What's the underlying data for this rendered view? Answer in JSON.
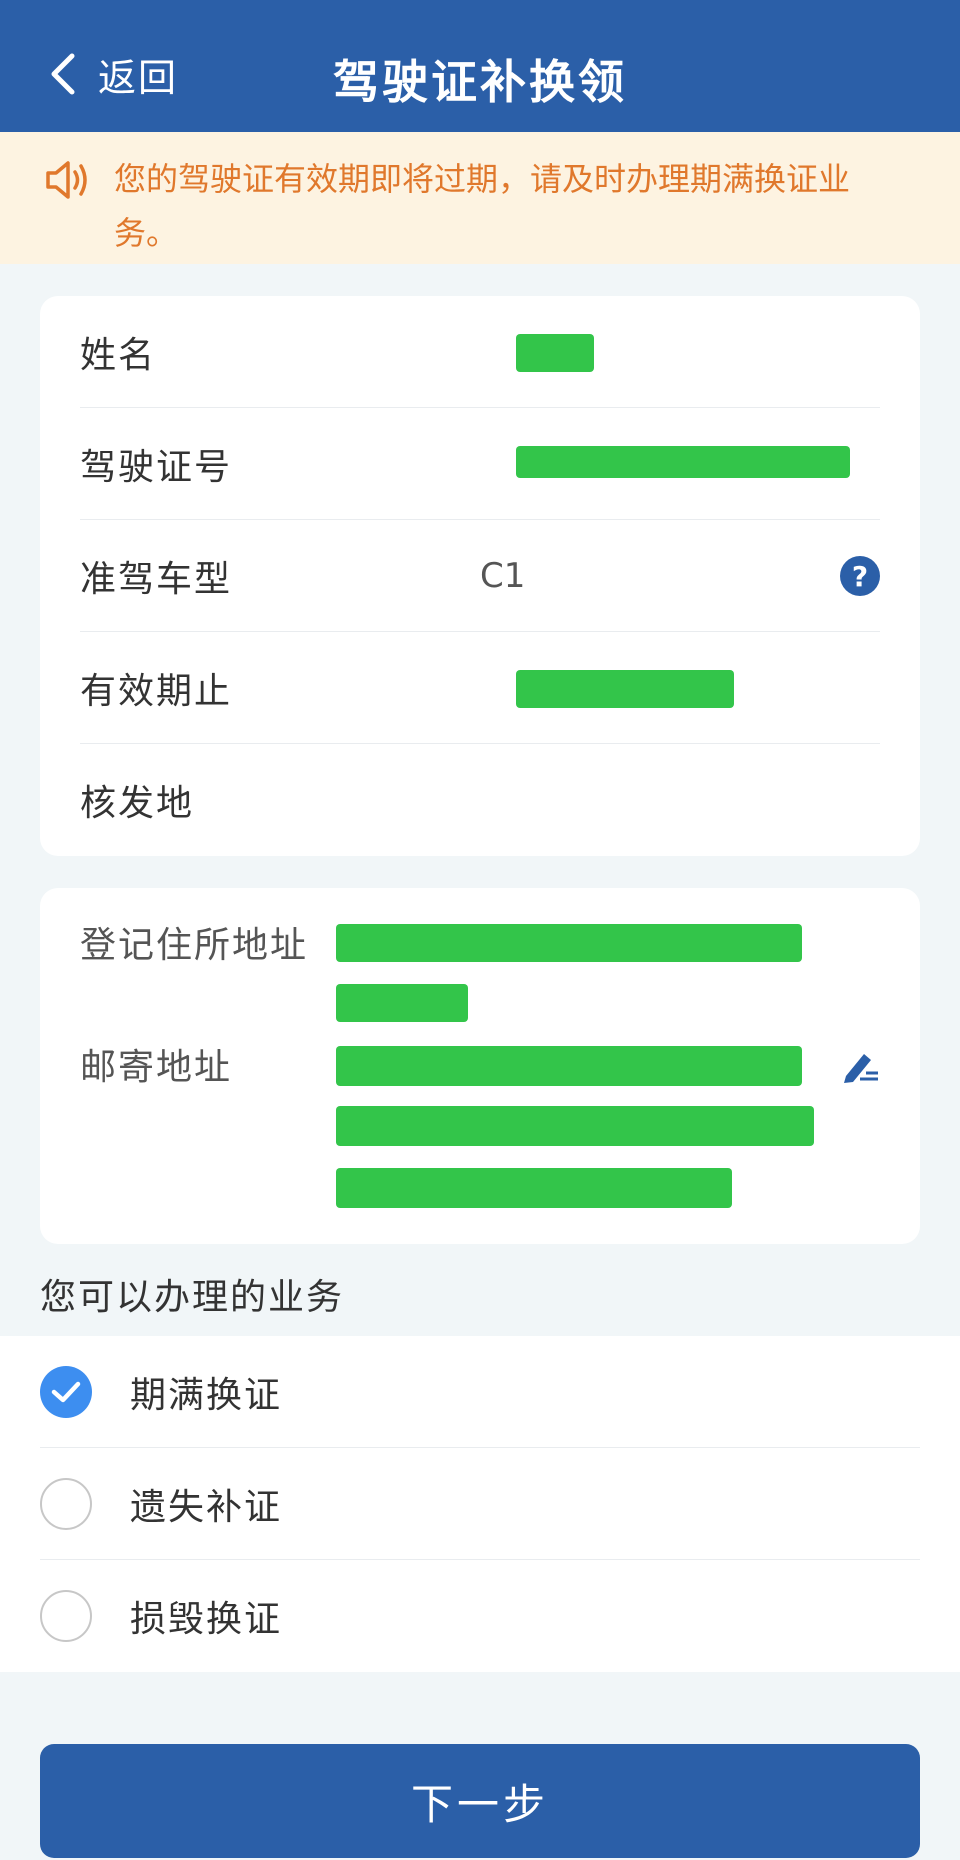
{
  "header": {
    "back_label": "返回",
    "title": "驾驶证补换领"
  },
  "notice": {
    "text": "您的驾驶证有效期即将过期，请及时办理期满换证业务。"
  },
  "license_info": {
    "name_label": "姓名",
    "license_no_label": "驾驶证号",
    "vehicle_class_label": "准驾车型",
    "vehicle_class_value": "C1",
    "help_icon_text": "?",
    "valid_until_label": "有效期止",
    "issuer_label": "核发地"
  },
  "address": {
    "registered_label": "登记住所地址",
    "mailing_label": "邮寄地址"
  },
  "business": {
    "section_title": "您可以办理的业务",
    "options": [
      {
        "label": "期满换证",
        "checked": true
      },
      {
        "label": "遗失补证",
        "checked": false
      },
      {
        "label": "损毁换证",
        "checked": false
      }
    ]
  },
  "footer": {
    "next_label": "下一步"
  },
  "colors": {
    "primary": "#2b5fa8",
    "notice_bg": "#fdf3e1",
    "notice_text": "#e0782c",
    "check": "#3d8ef0",
    "redaction": "#33c54a"
  },
  "icons": {
    "back": "chevron-left-icon",
    "notice": "speaker-icon",
    "help": "question-icon",
    "edit": "edit-pen-icon",
    "check": "checkmark-icon"
  }
}
